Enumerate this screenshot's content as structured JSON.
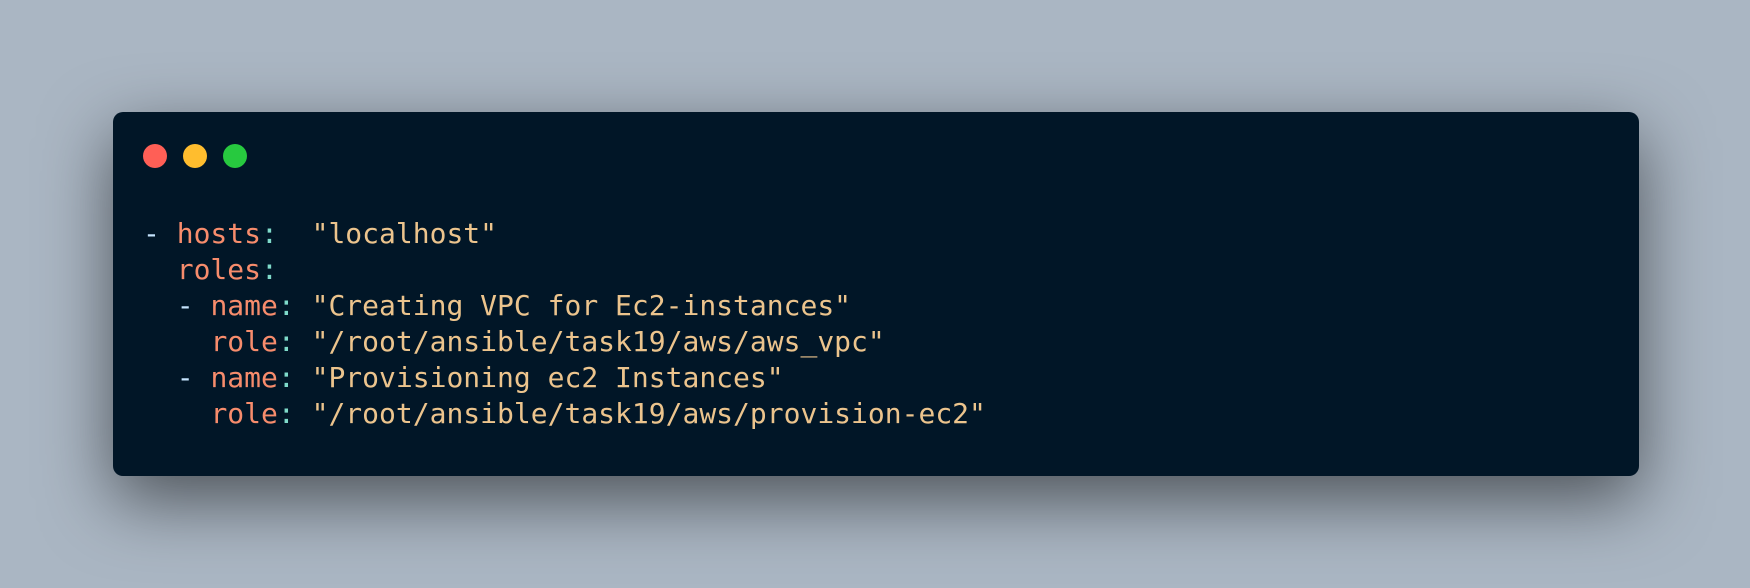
{
  "window": {
    "controls": [
      {
        "name": "close",
        "color": "#ff5f56"
      },
      {
        "name": "minimize",
        "color": "#ffbd2e"
      },
      {
        "name": "maximize",
        "color": "#27c93f"
      }
    ]
  },
  "code": {
    "colors": {
      "background": "#011627",
      "key": "#f78c6c",
      "string": "#ecc48d",
      "punctuation": "#7fdbca"
    },
    "lines": [
      {
        "indent": "",
        "dash": "- ",
        "key": "hosts",
        "colon": ":",
        "spacer": "  ",
        "value": "\"localhost\""
      },
      {
        "indent": "  ",
        "dash": "",
        "key": "roles",
        "colon": ":",
        "spacer": "",
        "value": ""
      },
      {
        "indent": "  ",
        "dash": "- ",
        "key": "name",
        "colon": ":",
        "spacer": " ",
        "value": "\"Creating VPC for Ec2-instances\""
      },
      {
        "indent": "    ",
        "dash": "",
        "key": "role",
        "colon": ":",
        "spacer": " ",
        "value": "\"/root/ansible/task19/aws/aws_vpc\""
      },
      {
        "indent": "  ",
        "dash": "- ",
        "key": "name",
        "colon": ":",
        "spacer": " ",
        "value": "\"Provisioning ec2 Instances\""
      },
      {
        "indent": "    ",
        "dash": "",
        "key": "role",
        "colon": ":",
        "spacer": " ",
        "value": "\"/root/ansible/task19/aws/provision-ec2\""
      }
    ]
  }
}
